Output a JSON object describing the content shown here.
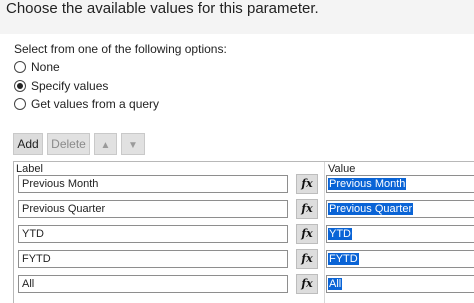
{
  "header": {
    "title": "Choose the available values for this parameter."
  },
  "options": {
    "label": "Select from one of the following options:",
    "radios": [
      {
        "label": "None",
        "checked": false
      },
      {
        "label": "Specify values",
        "checked": true
      },
      {
        "label": "Get values from a query",
        "checked": false
      }
    ]
  },
  "toolbar": {
    "add_label": "Add",
    "delete_label": "Delete",
    "move_up_icon": "arrow-up-icon",
    "move_down_icon": "arrow-down-icon"
  },
  "grid": {
    "columns": {
      "label": "Label",
      "value": "Value"
    },
    "fx_label": "fx",
    "rows": [
      {
        "label": "Previous Month",
        "value": "Previous Month"
      },
      {
        "label": "Previous Quarter",
        "value": "Previous Quarter"
      },
      {
        "label": "YTD",
        "value": "YTD"
      },
      {
        "label": "FYTD",
        "value": "FYTD"
      },
      {
        "label": "All",
        "value": "All"
      }
    ]
  },
  "colors": {
    "selection": "#0a64d6",
    "header_bg": "#f4f4f4",
    "button_bg": "#dcdcdc"
  }
}
